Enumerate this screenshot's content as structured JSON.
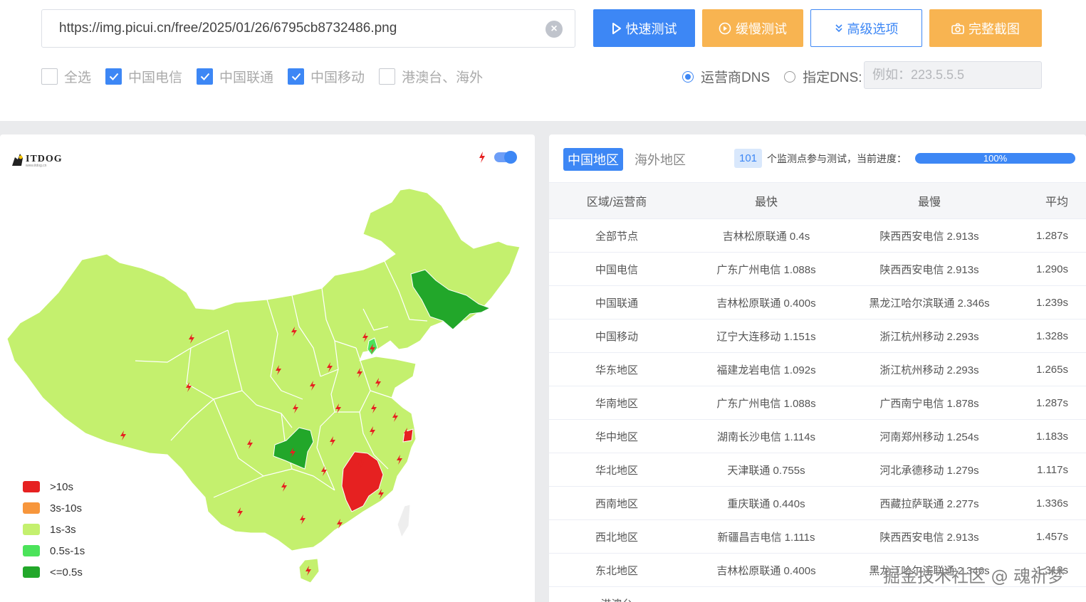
{
  "url_input": {
    "value": "https://img.picui.cn/free/2025/01/26/6795cb8732486.png",
    "clear_icon": "close-circle-icon"
  },
  "buttons": {
    "fast": {
      "label": "快速测试",
      "icon": "play-icon"
    },
    "slow": {
      "label": "缓慢测试",
      "icon": "slow-icon"
    },
    "advanced": {
      "label": "高级选项",
      "icon": "chevron-down-double-icon"
    },
    "screenshot": {
      "label": "完整截图",
      "icon": "camera-icon"
    }
  },
  "checkboxes": [
    {
      "label": "全选",
      "checked": false
    },
    {
      "label": "中国电信",
      "checked": true
    },
    {
      "label": "中国联通",
      "checked": true
    },
    {
      "label": "中国移动",
      "checked": true
    },
    {
      "label": "港澳台、海外",
      "checked": false
    }
  ],
  "dns": {
    "option_carrier": "运营商DNS",
    "option_custom": "指定DNS:",
    "selected": "carrier",
    "placeholder": "例如：223.5.5.5"
  },
  "map_panel": {
    "logo_text": "ITDOG",
    "logo_sub": "www.itdog.cn",
    "toggle_on": true,
    "colors": {
      "gt10": "#e62121",
      "s3to10": "#f7963c",
      "s1to3": "#c4f06e",
      "s05to1": "#4be35a",
      "le05": "#22a72a"
    },
    "legend": [
      {
        "label": ">10s",
        "color": "#e62121"
      },
      {
        "label": "3s-10s",
        "color": "#f7963c"
      },
      {
        "label": "1s-3s",
        "color": "#c4f06e"
      },
      {
        "label": "0.5s-1s",
        "color": "#4be35a"
      },
      {
        "label": "<=0.5s",
        "color": "#22a72a"
      }
    ]
  },
  "results": {
    "tabs": [
      "中国地区",
      "海外地区"
    ],
    "active_tab": 0,
    "node_count": "101",
    "progress_label": "个监测点参与测试，当前进度：",
    "progress_value": "100%",
    "columns": [
      "区域/运营商",
      "最快",
      "最慢",
      "平均"
    ],
    "rows": [
      [
        "全部节点",
        "吉林松原联通 0.4s",
        "陕西西安电信 2.913s",
        "1.287s"
      ],
      [
        "中国电信",
        "广东广州电信 1.088s",
        "陕西西安电信 2.913s",
        "1.290s"
      ],
      [
        "中国联通",
        "吉林松原联通 0.400s",
        "黑龙江哈尔滨联通 2.346s",
        "1.239s"
      ],
      [
        "中国移动",
        "辽宁大连移动 1.151s",
        "浙江杭州移动 2.293s",
        "1.328s"
      ],
      [
        "华东地区",
        "福建龙岩电信 1.092s",
        "浙江杭州移动 2.293s",
        "1.265s"
      ],
      [
        "华南地区",
        "广东广州电信 1.088s",
        "广西南宁电信 1.878s",
        "1.287s"
      ],
      [
        "华中地区",
        "湖南长沙电信 1.114s",
        "河南郑州移动 1.254s",
        "1.183s"
      ],
      [
        "华北地区",
        "天津联通 0.755s",
        "河北承德移动 1.279s",
        "1.117s"
      ],
      [
        "西南地区",
        "重庆联通 0.440s",
        "西藏拉萨联通 2.277s",
        "1.336s"
      ],
      [
        "西北地区",
        "新疆昌吉电信 1.111s",
        "陕西西安电信 2.913s",
        "1.457s"
      ],
      [
        "东北地区",
        "吉林松原联通 0.400s",
        "黑龙江哈尔滨联通 2.346s",
        "1.318s"
      ],
      [
        "港澳台",
        "",
        "",
        ""
      ]
    ]
  },
  "watermark": "掘金技术社区 @ 魂祈梦"
}
